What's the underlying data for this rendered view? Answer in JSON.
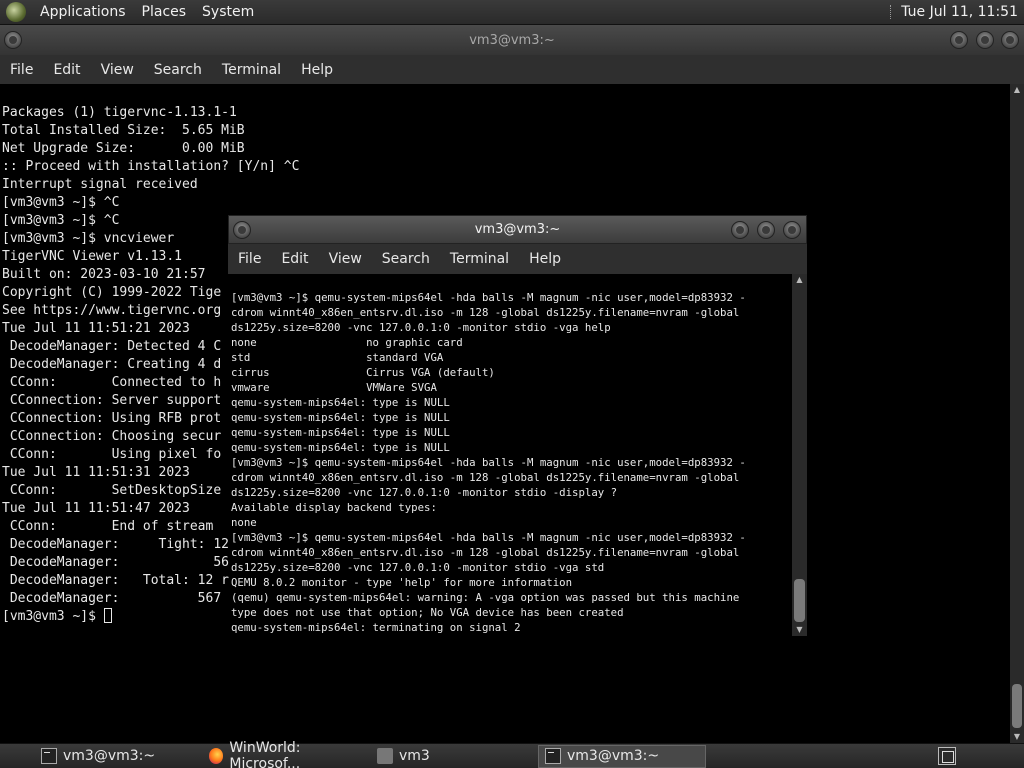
{
  "top_panel": {
    "menus": [
      "Applications",
      "Places",
      "System"
    ],
    "clock": "Tue Jul 11, 11:51"
  },
  "back_window": {
    "title": "vm3@vm3:~",
    "menu": [
      "File",
      "Edit",
      "View",
      "Search",
      "Terminal",
      "Help"
    ],
    "lines": [
      "Packages (1) tigervnc-1.13.1-1",
      "",
      "Total Installed Size:  5.65 MiB",
      "Net Upgrade Size:      0.00 MiB",
      "",
      ":: Proceed with installation? [Y/n] ^C",
      "Interrupt signal received",
      "",
      "[vm3@vm3 ~]$ ^C",
      "[vm3@vm3 ~]$ ^C",
      "[vm3@vm3 ~]$ vncviewer",
      "",
      "TigerVNC Viewer v1.13.1",
      "Built on: 2023-03-10 21:57",
      "Copyright (C) 1999-2022 Tige",
      "See https://www.tigervnc.org",
      "",
      "Tue Jul 11 11:51:21 2023",
      " DecodeManager: Detected 4 C",
      " DecodeManager: Creating 4 d",
      " CConn:       Connected to h",
      " CConnection: Server support",
      " CConnection: Using RFB prot",
      " CConnection: Choosing secur",
      " CConn:       Using pixel fo",
      "",
      "Tue Jul 11 11:51:31 2023",
      " CConn:       SetDesktopSize",
      "",
      "Tue Jul 11 11:51:47 2023",
      " CConn:       End of stream",
      " DecodeManager:     Tight: 12 rects, 614.4 kpixels",
      " DecodeManager:            567 B (1:4334.65 ratio)",
      " DecodeManager:   Total: 12 rects, 614.4 kpixels",
      " DecodeManager:          567 B (1:4334.65 ratio)"
    ],
    "prompt": "[vm3@vm3 ~]$ "
  },
  "front_window": {
    "title": "vm3@vm3:~",
    "menu": [
      "File",
      "Edit",
      "View",
      "Search",
      "Terminal",
      "Help"
    ],
    "lines": [
      "[vm3@vm3 ~]$ qemu-system-mips64el -hda balls -M magnum -nic user,model=dp83932 -",
      "cdrom winnt40_x86en_entsrv.dl.iso -m 128 -global ds1225y.filename=nvram -global",
      "ds1225y.size=8200 -vnc 127.0.0.1:0 -monitor stdio -vga help",
      "none                 no graphic card",
      "std                  standard VGA",
      "cirrus               Cirrus VGA (default)",
      "vmware               VMWare SVGA",
      "qemu-system-mips64el: type is NULL",
      "qemu-system-mips64el: type is NULL",
      "qemu-system-mips64el: type is NULL",
      "qemu-system-mips64el: type is NULL",
      "[vm3@vm3 ~]$ qemu-system-mips64el -hda balls -M magnum -nic user,model=dp83932 -",
      "cdrom winnt40_x86en_entsrv.dl.iso -m 128 -global ds1225y.filename=nvram -global",
      "ds1225y.size=8200 -vnc 127.0.0.1:0 -monitor stdio -display ?",
      "Available display backend types:",
      "none",
      "[vm3@vm3 ~]$ qemu-system-mips64el -hda balls -M magnum -nic user,model=dp83932 -",
      "cdrom winnt40_x86en_entsrv.dl.iso -m 128 -global ds1225y.filename=nvram -global",
      "ds1225y.size=8200 -vnc 127.0.0.1:0 -monitor stdio -vga std",
      "QEMU 8.0.2 monitor - type 'help' for more information",
      "(qemu) qemu-system-mips64el: warning: A -vga option was passed but this machine",
      "type does not use that option; No VGA device has been created",
      "qemu-system-mips64el: terminating on signal 2"
    ],
    "prompt": "[vm3@vm3 ~]$ "
  },
  "taskbar": {
    "items": [
      {
        "label": "vm3@vm3:~",
        "icon": "terminal-icon",
        "active": false
      },
      {
        "label": "WinWorld: Microsof...",
        "icon": "firefox-icon",
        "active": false
      },
      {
        "label": "vm3",
        "icon": "folder-icon",
        "active": false
      },
      {
        "label": "vm3@vm3:~",
        "icon": "terminal-icon",
        "active": true
      }
    ]
  }
}
